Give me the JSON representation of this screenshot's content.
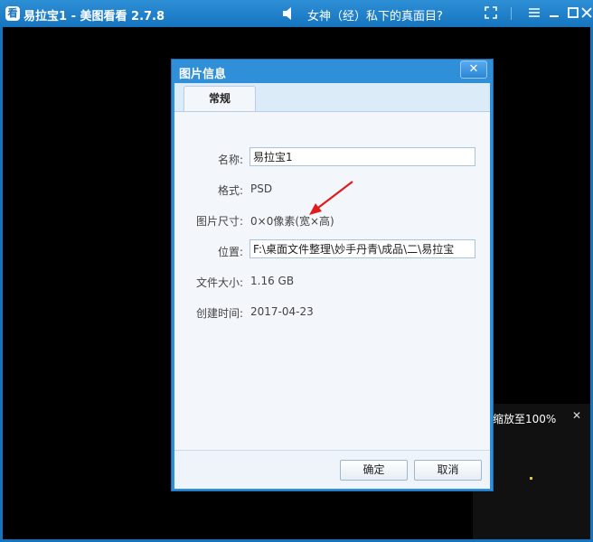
{
  "window": {
    "app_icon": "看",
    "title": "易拉宝1 - 美图看看 2.7.8",
    "marquee": "女神（经）私下的真面目?",
    "controls": [
      "fullscreen-icon",
      "menu-icon",
      "minimize-icon",
      "maximize-icon",
      "close-icon"
    ]
  },
  "zoom_tooltip": {
    "text": "缩放至100%",
    "close_label": "✕"
  },
  "dialog": {
    "title": "图片信息",
    "close_label": "✕",
    "tab": "常规",
    "fields": {
      "name_label": "名称:",
      "name_value": "易拉宝1",
      "format_label": "格式:",
      "format_value": "PSD",
      "size_label": "图片尺寸:",
      "size_value": "0×0像素(宽×高)",
      "location_label": "位置:",
      "location_value": "F:\\桌面文件整理\\妙手丹青\\成品\\二\\易拉宝",
      "filesize_label": "文件大小:",
      "filesize_value": "1.16 GB",
      "created_label": "创建时间:",
      "created_value": "2017-04-23"
    },
    "ok_label": "确定",
    "cancel_label": "取消"
  },
  "colors": {
    "titlebar": "#1674bf",
    "dialog_border": "#2f8fd8",
    "annotation_arrow": "#e01b1b"
  }
}
